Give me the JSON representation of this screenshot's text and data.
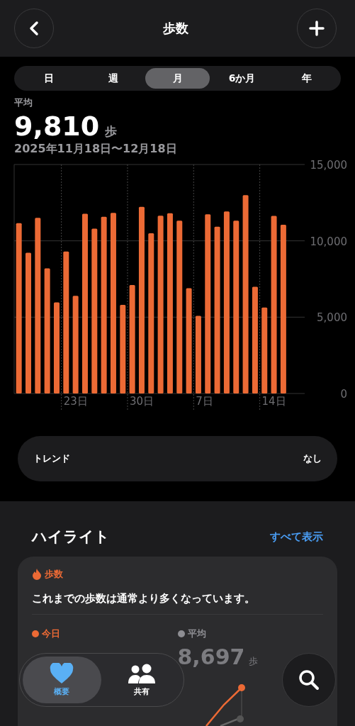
{
  "header": {
    "title": "歩数"
  },
  "periods": [
    {
      "label": "日",
      "selected": false
    },
    {
      "label": "週",
      "selected": false
    },
    {
      "label": "月",
      "selected": true
    },
    {
      "label": "6か月",
      "selected": false
    },
    {
      "label": "年",
      "selected": false
    }
  ],
  "summary": {
    "label": "平均",
    "value": "9,810",
    "unit": "歩",
    "range": "2025年11月18日〜12月18日"
  },
  "chart_data": {
    "type": "bar",
    "orientation": "vertical",
    "ylim": [
      0,
      15000
    ],
    "yticks": [
      {
        "value": 0,
        "label": "0"
      },
      {
        "value": 5000,
        "label": "5,000"
      },
      {
        "value": 10000,
        "label": "10,000"
      },
      {
        "value": 15000,
        "label": "15,000"
      }
    ],
    "series": [
      {
        "color": "#ec6a35",
        "values": [
          11160,
          9220,
          11500,
          8200,
          5970,
          9300,
          6400,
          11770,
          10800,
          11580,
          11830,
          5810,
          7100,
          12230,
          10500,
          11640,
          11810,
          11320,
          6900,
          5090,
          11740,
          10930,
          11920,
          11320,
          12990,
          6990,
          5630,
          11630,
          11050
        ]
      }
    ]
  },
  "x_axis_labels": [
    "23日",
    "30日",
    "7日",
    "14日"
  ],
  "trend": {
    "label": "トレンド",
    "value": "なし"
  },
  "highlights": {
    "title": "ハイライト",
    "link": "すべて表示",
    "card": {
      "category": "歩数",
      "message": "これまでの歩数は通常より多くなっています。",
      "legend": [
        {
          "label": "今日",
          "color": "#ec6a35"
        },
        {
          "label": "平均",
          "color": "#8e8e93",
          "value": "8,697",
          "unit": "歩"
        }
      ]
    }
  },
  "tab_bar": [
    {
      "kind": "heart",
      "label": "概要",
      "selected": true
    },
    {
      "kind": "people",
      "label": "共有",
      "selected": false
    }
  ]
}
